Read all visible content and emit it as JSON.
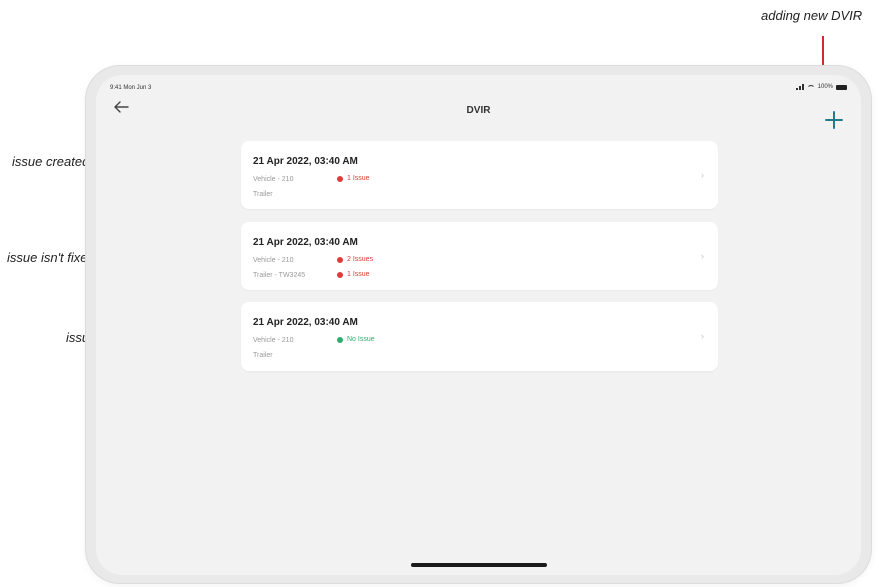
{
  "annotations": {
    "add": "adding new DVIR",
    "created": "issue created time",
    "not_fixed": "issue isn't fixed yet",
    "fixed": "issue fixed"
  },
  "status_bar": {
    "time": "9:41 Mon Jun 3",
    "battery": "100%"
  },
  "header": {
    "title": "DVIR",
    "back_icon": "arrow-left-icon",
    "add_icon": "plus-icon"
  },
  "cards": [
    {
      "date": "21 Apr 2022, 03:40 AM",
      "rows": [
        {
          "label": "Vehicle - 210",
          "status": "1 Issue",
          "status_color": "#e03b3b"
        },
        {
          "label": "Trailer",
          "status": "",
          "status_color": ""
        }
      ]
    },
    {
      "date": "21 Apr 2022, 03:40 AM",
      "rows": [
        {
          "label": "Vehicle - 210",
          "status": "2 Issues",
          "status_color": "#e03b3b"
        },
        {
          "label": "Trailer - TW3245",
          "status": "1 Issue",
          "status_color": "#e03b3b"
        }
      ]
    },
    {
      "date": "21 Apr 2022, 03:40 AM",
      "rows": [
        {
          "label": "Vehicle - 210",
          "status": "No Issue",
          "status_color": "#2fae6a"
        },
        {
          "label": "Trailer",
          "status": "",
          "status_color": ""
        }
      ]
    }
  ],
  "colors": {
    "accent": "#1f7a8c",
    "annotation_arrow": "#d42a2a"
  }
}
